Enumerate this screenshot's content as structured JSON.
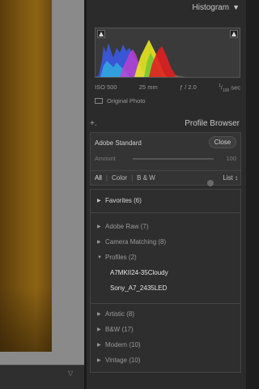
{
  "histogram": {
    "title": "Histogram",
    "iso": "ISO 500",
    "focal": "25 mm",
    "aperture": "ƒ / 2.0",
    "shutter_num": "1",
    "shutter_den": "100",
    "shutter_unit": "sec",
    "original_photo": "Original Photo"
  },
  "profile_browser": {
    "plus": "+.",
    "title": "Profile Browser",
    "profile_name": "Adobe Standard",
    "close_label": "Close",
    "amount_label": "Amount",
    "amount_value": "100",
    "filters": [
      "All",
      "Color",
      "B & W"
    ],
    "list_label": "List ↕",
    "groups": [
      {
        "label": "Favorites (6)",
        "expanded": false
      },
      {
        "label": "Adobe Raw (7)",
        "expanded": false
      },
      {
        "label": "Camera Matching (8)",
        "expanded": false
      },
      {
        "label": "Profiles (2)",
        "expanded": true,
        "items": [
          "A7MKII24-35Cloudy",
          "Sony_A7_2435LED"
        ]
      },
      {
        "label": "Artistic (8)",
        "expanded": false
      },
      {
        "label": "B&W (17)",
        "expanded": false
      },
      {
        "label": "Modern (10)",
        "expanded": false
      },
      {
        "label": "Vintage (10)",
        "expanded": false
      }
    ]
  },
  "colors": {
    "panel_bg": "#2b2b2b",
    "text": "#c8c8c8",
    "hist_blue": "#3a5cf0",
    "hist_red": "#e02020",
    "hist_yellow": "#e8e820",
    "hist_magenta": "#c040d0",
    "hist_cyan": "#30b0e0"
  }
}
